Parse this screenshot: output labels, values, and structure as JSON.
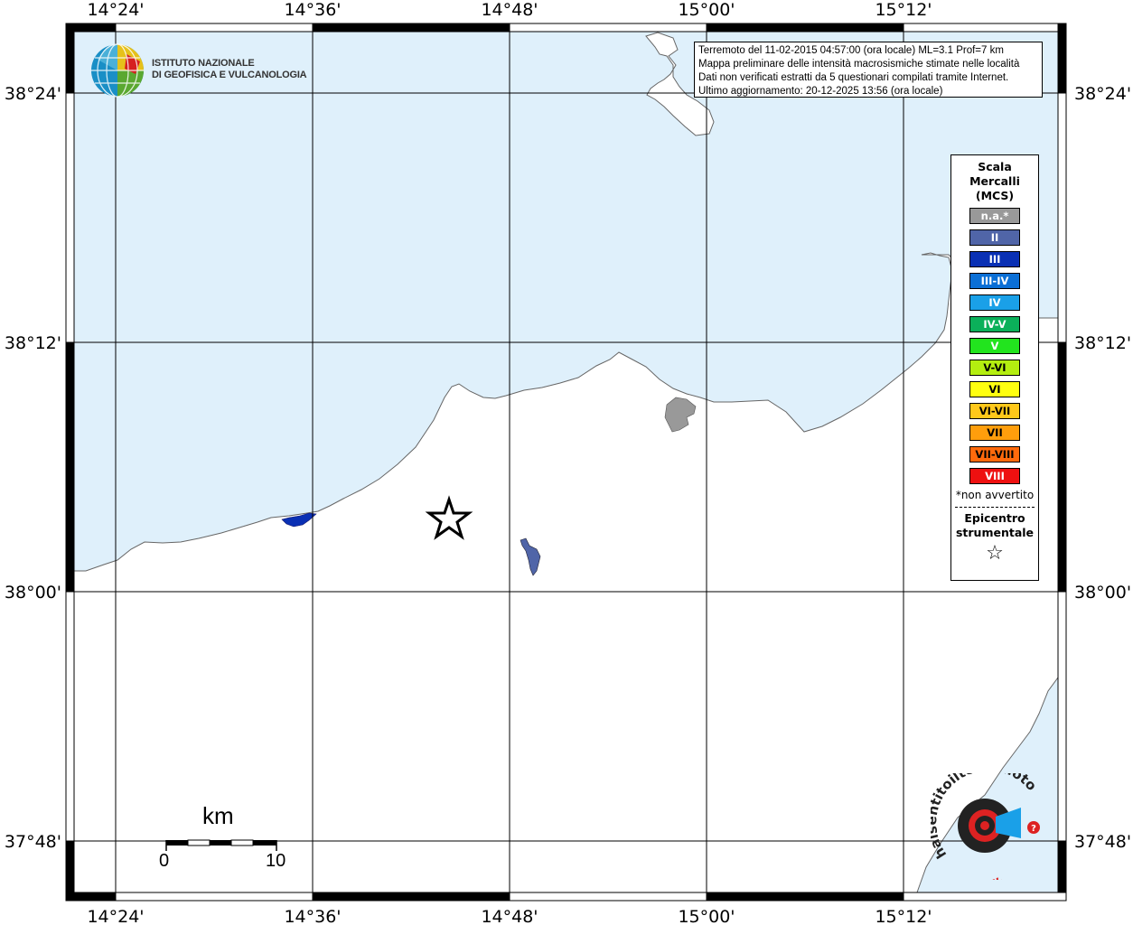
{
  "map": {
    "lon_labels_top": [
      "14°24'",
      "14°36'",
      "14°48'",
      "15°00'",
      "15°12'"
    ],
    "lon_labels_bottom": [
      "14°24'",
      "14°36'",
      "14°48'",
      "15°00'",
      "15°12'"
    ],
    "lat_labels_left": [
      "38°24'",
      "38°12'",
      "38°00'",
      "37°48'"
    ],
    "lat_labels_right": [
      "38°24'",
      "38°12'",
      "38°00'",
      "37°48'"
    ],
    "sea_color": "#dff0fb",
    "land_color": "#ffffff"
  },
  "info": {
    "line1": "Terremoto del 11-02-2015 04:57:00 (ora locale) ML=3.1 Prof=7 km",
    "line2": "Mappa preliminare delle intensità macrosismiche stimate nelle località",
    "line3": "Dati non verificati estratti da 5 questionari compilati tramite Internet.",
    "line4": "Ultimo aggiornamento: 20-12-2025 13:56 (ora locale)"
  },
  "logo": {
    "line1": "ISTITUTO NAZIONALE",
    "line2": "DI GEOFISICA E VULCANOLOGIA"
  },
  "legend": {
    "title1": "Scala",
    "title2": "Mercalli",
    "title3": "(MCS)",
    "items": [
      {
        "label": "n.a.*",
        "color": "#999999"
      },
      {
        "label": "II",
        "color": "#5065a8"
      },
      {
        "label": "III",
        "color": "#0a30b4"
      },
      {
        "label": "III-IV",
        "color": "#0b6fd6"
      },
      {
        "label": "IV",
        "color": "#1aa0e8"
      },
      {
        "label": "IV-V",
        "color": "#0bb05a"
      },
      {
        "label": "V",
        "color": "#22e41e"
      },
      {
        "label": "V-VI",
        "color": "#b4ee10"
      },
      {
        "label": "VI",
        "color": "#ffff10"
      },
      {
        "label": "VI-VII",
        "color": "#ffc81a"
      },
      {
        "label": "VII",
        "color": "#ff9e0c"
      },
      {
        "label": "VII-VIII",
        "color": "#ff6a0c"
      },
      {
        "label": "VIII",
        "color": "#ee1010"
      }
    ],
    "note": "*non avvertito",
    "epi1": "Epicentro",
    "epi2": "strumentale"
  },
  "scale": {
    "title": "km",
    "left": "0",
    "right": "10"
  },
  "hst": {
    "text": "haisentitoilterremoto.it",
    "www": "www."
  }
}
